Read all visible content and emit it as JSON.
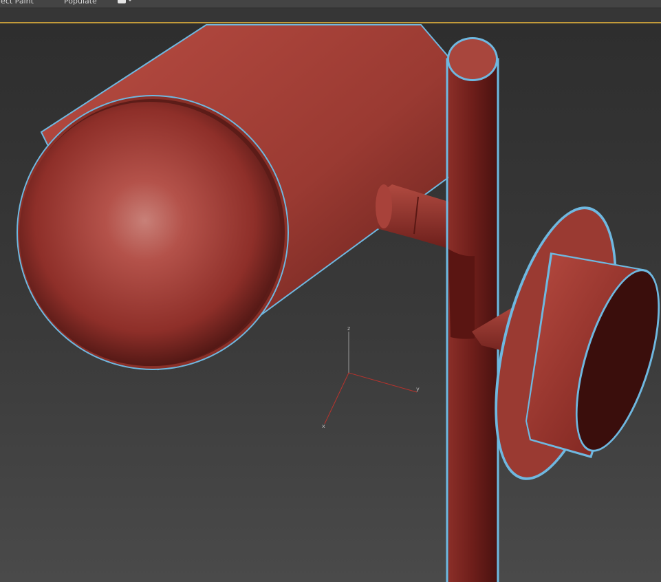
{
  "ribbon": {
    "tabs": [
      "ject Paint",
      "Populate"
    ],
    "dropdown_icon": "viewport-mode-icon"
  },
  "viewport": {
    "active_border_color": "#c29a3a",
    "selection_outline_color": "#6fb8e0",
    "object_color": "#b0433a",
    "axis_tripod": {
      "labels": [
        "z",
        "y",
        "x"
      ],
      "colors": {
        "z": "#9a9a9a",
        "y": "#b8332d",
        "x": "#b8332d"
      }
    }
  }
}
